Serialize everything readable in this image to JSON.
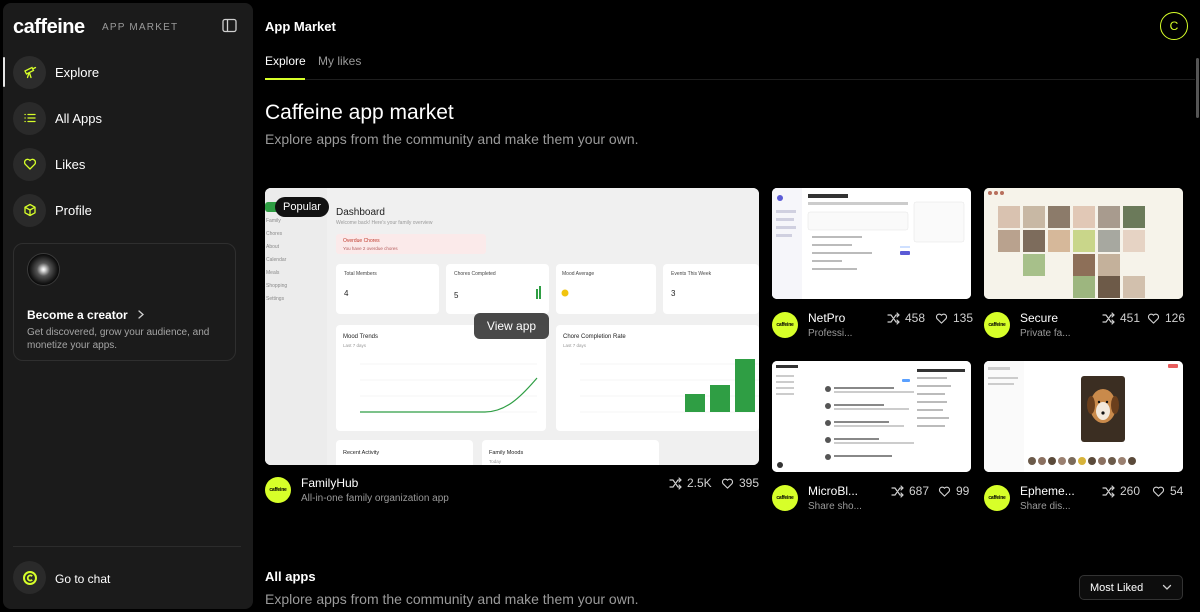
{
  "sidebar": {
    "brand": "caffeine",
    "brand_sub": "APP MARKET",
    "items": [
      {
        "label": "Explore",
        "icon": "telescope-icon"
      },
      {
        "label": "All Apps",
        "icon": "list-icon"
      },
      {
        "label": "Likes",
        "icon": "heart-icon"
      },
      {
        "label": "Profile",
        "icon": "cube-icon"
      }
    ],
    "creator": {
      "title": "Become a creator",
      "description": "Get discovered, grow your audience, and monetize your apps."
    },
    "go_to_chat": "Go to chat"
  },
  "header": {
    "title": "App Market",
    "avatar_initial": "C"
  },
  "tabs": [
    {
      "label": "Explore",
      "active": true
    },
    {
      "label": "My likes",
      "active": false
    }
  ],
  "hero": {
    "title": "Caffeine app market",
    "subtitle": "Explore apps from the community and make them your own."
  },
  "featured": {
    "badge": "Popular",
    "view_label": "View app",
    "name": "FamilyHub",
    "description": "All-in-one family organization app",
    "remixes": "2.5K",
    "likes": "395",
    "logo_text": "caffeine",
    "preview": {
      "title": "Dashboard",
      "subtitle": "Welcome back! Here's your family overview",
      "nav": [
        "Family",
        "Chores",
        "About",
        "Calendar",
        "Meals",
        "Shopping",
        "Settings"
      ],
      "alert_title": "Overdue Chores",
      "alert_text": "You have 2 overdue chores",
      "stats": [
        {
          "label": "Total Members",
          "value": "4"
        },
        {
          "label": "Chores Completed",
          "value": "5"
        },
        {
          "label": "Mood Average",
          "value": ""
        },
        {
          "label": "Events This Week",
          "value": "3"
        }
      ],
      "chart1_title": "Mood Trends",
      "chart1_sub": "Last 7 days",
      "chart2_title": "Chore Completion Rate",
      "chart2_sub": "Last 7 days",
      "recent": "Recent Activity",
      "family_moods": "Family Moods",
      "today": "Today"
    }
  },
  "apps": [
    {
      "name": "NetPro",
      "description": "Professi...",
      "remixes": "458",
      "likes": "135",
      "logo_text": "caffeine"
    },
    {
      "name": "Secure",
      "description": "Private fa...",
      "remixes": "451",
      "likes": "126",
      "logo_text": "caffeine"
    },
    {
      "name": "MicroBl...",
      "description": "Share sho...",
      "remixes": "687",
      "likes": "99",
      "logo_text": "caffeine"
    },
    {
      "name": "Epheme...",
      "description": "Share dis...",
      "remixes": "260",
      "likes": "54",
      "logo_text": "caffeine"
    }
  ],
  "all_apps": {
    "title": "All apps",
    "subtitle": "Explore apps from the community and make them your own.",
    "sort_value": "Most Liked"
  },
  "colors": {
    "accent": "#d7ff29",
    "background": "#000000",
    "sidebar": "#1b1b1b"
  }
}
